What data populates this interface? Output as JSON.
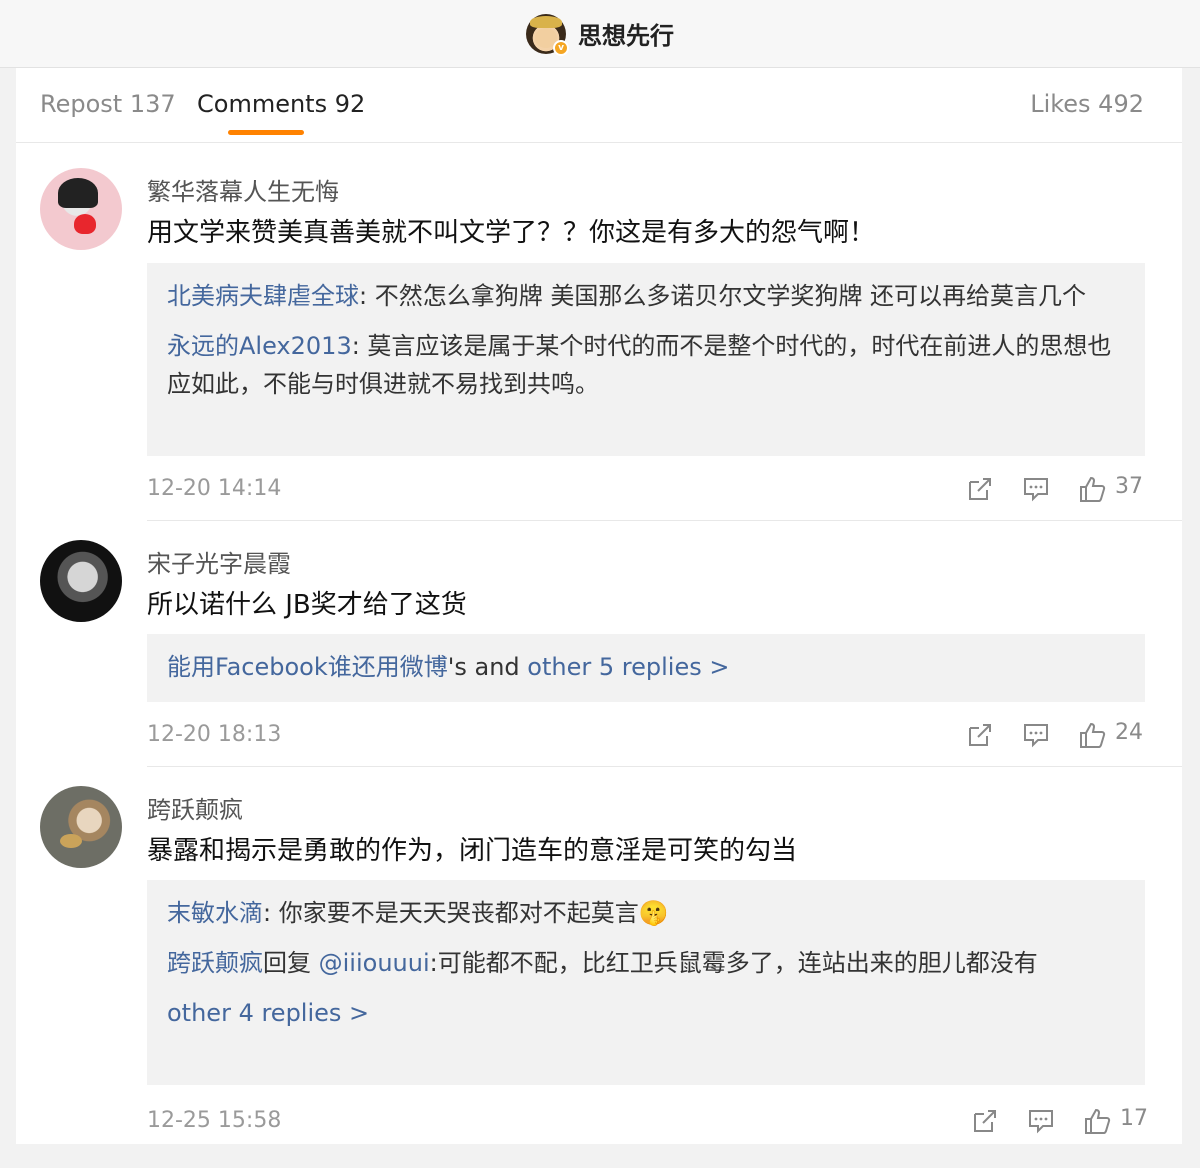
{
  "header": {
    "title": "思想先行",
    "badge": "v"
  },
  "tabs": {
    "repost": "Repost 137",
    "comments": "Comments 92",
    "likes": "Likes 492"
  },
  "comments": [
    {
      "user": "繁华落幕人生无悔",
      "text": "用文学来赞美真善美就不叫文学了？？你这是有多大的怨气啊！",
      "replies": [
        {
          "name": "北美病夫肆虐全球",
          "text": ": 不然怎么拿狗牌 美国那么多诺贝尔文学奖狗牌 还可以再给莫言几个"
        },
        {
          "name": "永远的Alex2013",
          "text": ": 莫言应该是属于某个时代的而不是整个时代的，时代在前进人的思想也应如此，不能与时俱进就不易找到共鸣。"
        }
      ],
      "time": "12-20 14:14",
      "likes": "37"
    },
    {
      "user": "宋子光字晨霞",
      "text": "所以诺什么 JB奖才给了这货",
      "replies_summary": {
        "name": "能用Facebook谁还用微博",
        "mid": "'s and ",
        "link": "other 5 replies >"
      },
      "time": "12-20 18:13",
      "likes": "24"
    },
    {
      "user": "跨跃颠疯",
      "text": "暴露和揭示是勇敢的作为，闭门造车的意淫是可笑的勾当",
      "replies": [
        {
          "name": "末敏水滴",
          "text": ": 你家要不是天天哭丧都对不起莫言",
          "emoji": "🤫"
        },
        {
          "name": "跨跃颠疯",
          "mid": "回复 ",
          "mention": "@iiiouuui",
          "text": ":可能都不配，比红卫兵鼠霉多了，连站出来的胆儿都没有"
        }
      ],
      "more": "other 4 replies >",
      "time": "12-25 15:58",
      "likes": "17"
    }
  ],
  "icons": {
    "share": "share-icon",
    "comment": "comment-icon",
    "like": "thumbs-up-icon"
  }
}
